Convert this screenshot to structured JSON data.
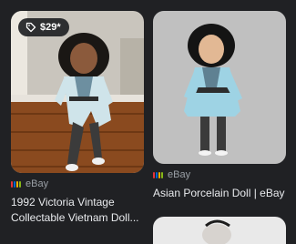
{
  "results": [
    {
      "price": "$29*",
      "source": "eBay",
      "title_line1": "1992 Victoria Vintage",
      "title_line2": "Collectable Vietnam Doll..."
    },
    {
      "source": "eBay",
      "title": "Asian Porcelain Doll | eBay"
    }
  ],
  "colors": {
    "background": "#202124",
    "text": "#e8eaed",
    "secondary_text": "#9aa0a6",
    "favicon": [
      "#e53238",
      "#0064d2",
      "#f5af02",
      "#86b817"
    ]
  },
  "icons": {
    "price_tag": "tag-icon",
    "source": "ebay-favicon"
  }
}
